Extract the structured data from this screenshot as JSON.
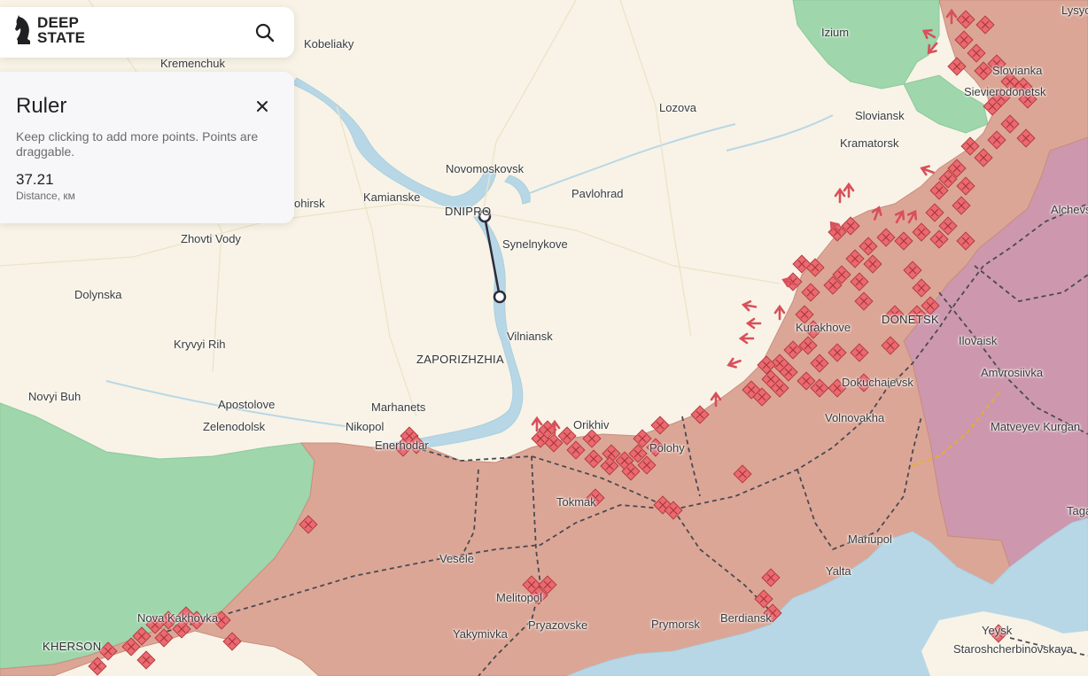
{
  "brand": {
    "line1": "DEEP",
    "line2": "STATE"
  },
  "search": {
    "icon": "search-icon"
  },
  "ruler": {
    "title": "Ruler",
    "hint": "Keep clicking to add more points. Points are draggable.",
    "distance": "37.21",
    "distance_label": "Distance, км",
    "close_icon": "close-icon"
  },
  "cities": [
    "Kobeliaky",
    "Kremenchuk",
    "Izium",
    "Lysychansk",
    "Sievierodonetsk",
    "Slovianka",
    "Lozova",
    "Sloviansk",
    "Kramatorsk",
    "Novomoskovsk",
    "Kamianske",
    "ohirsk",
    "DNIPRO",
    "Pavlohrad",
    "Synelnykove",
    "Zhovti Vody",
    "Alchevsk",
    "Dolynska",
    "Kurakhove",
    "DONETSK",
    "Ilovaisk",
    "Vilniansk",
    "Kryvyi Rih",
    "ZAPORIZHZHIA",
    "Amvrosiivka",
    "Novyi Buh",
    "Dokuchaievsk",
    "Apostolove",
    "Marhanets",
    "Orikhiv",
    "Volnovakha",
    "Matveyev Kurgan",
    "Zelenodolsk",
    "Nikopol",
    "Enerhodar",
    "Polohy",
    "Tokmak",
    "Taganrog",
    "Mariupol",
    "Vesele",
    "Yalta",
    "Melitopol",
    "Nova Kakhovka",
    "Berdiansk",
    "Prymorsk",
    "KHERSON",
    "Yakymivka",
    "Pryazovske",
    "Yeysk",
    "Staroshcherbinovskaya"
  ],
  "colors": {
    "land": "#f8f3e6",
    "water": "#b8d7e6",
    "occupied": "#dca696",
    "occupied_pre2022": "#cd98ad",
    "liberated": "#9fd6ac",
    "marker": "#e8646a",
    "ruler_line": "#2c2c3a"
  }
}
